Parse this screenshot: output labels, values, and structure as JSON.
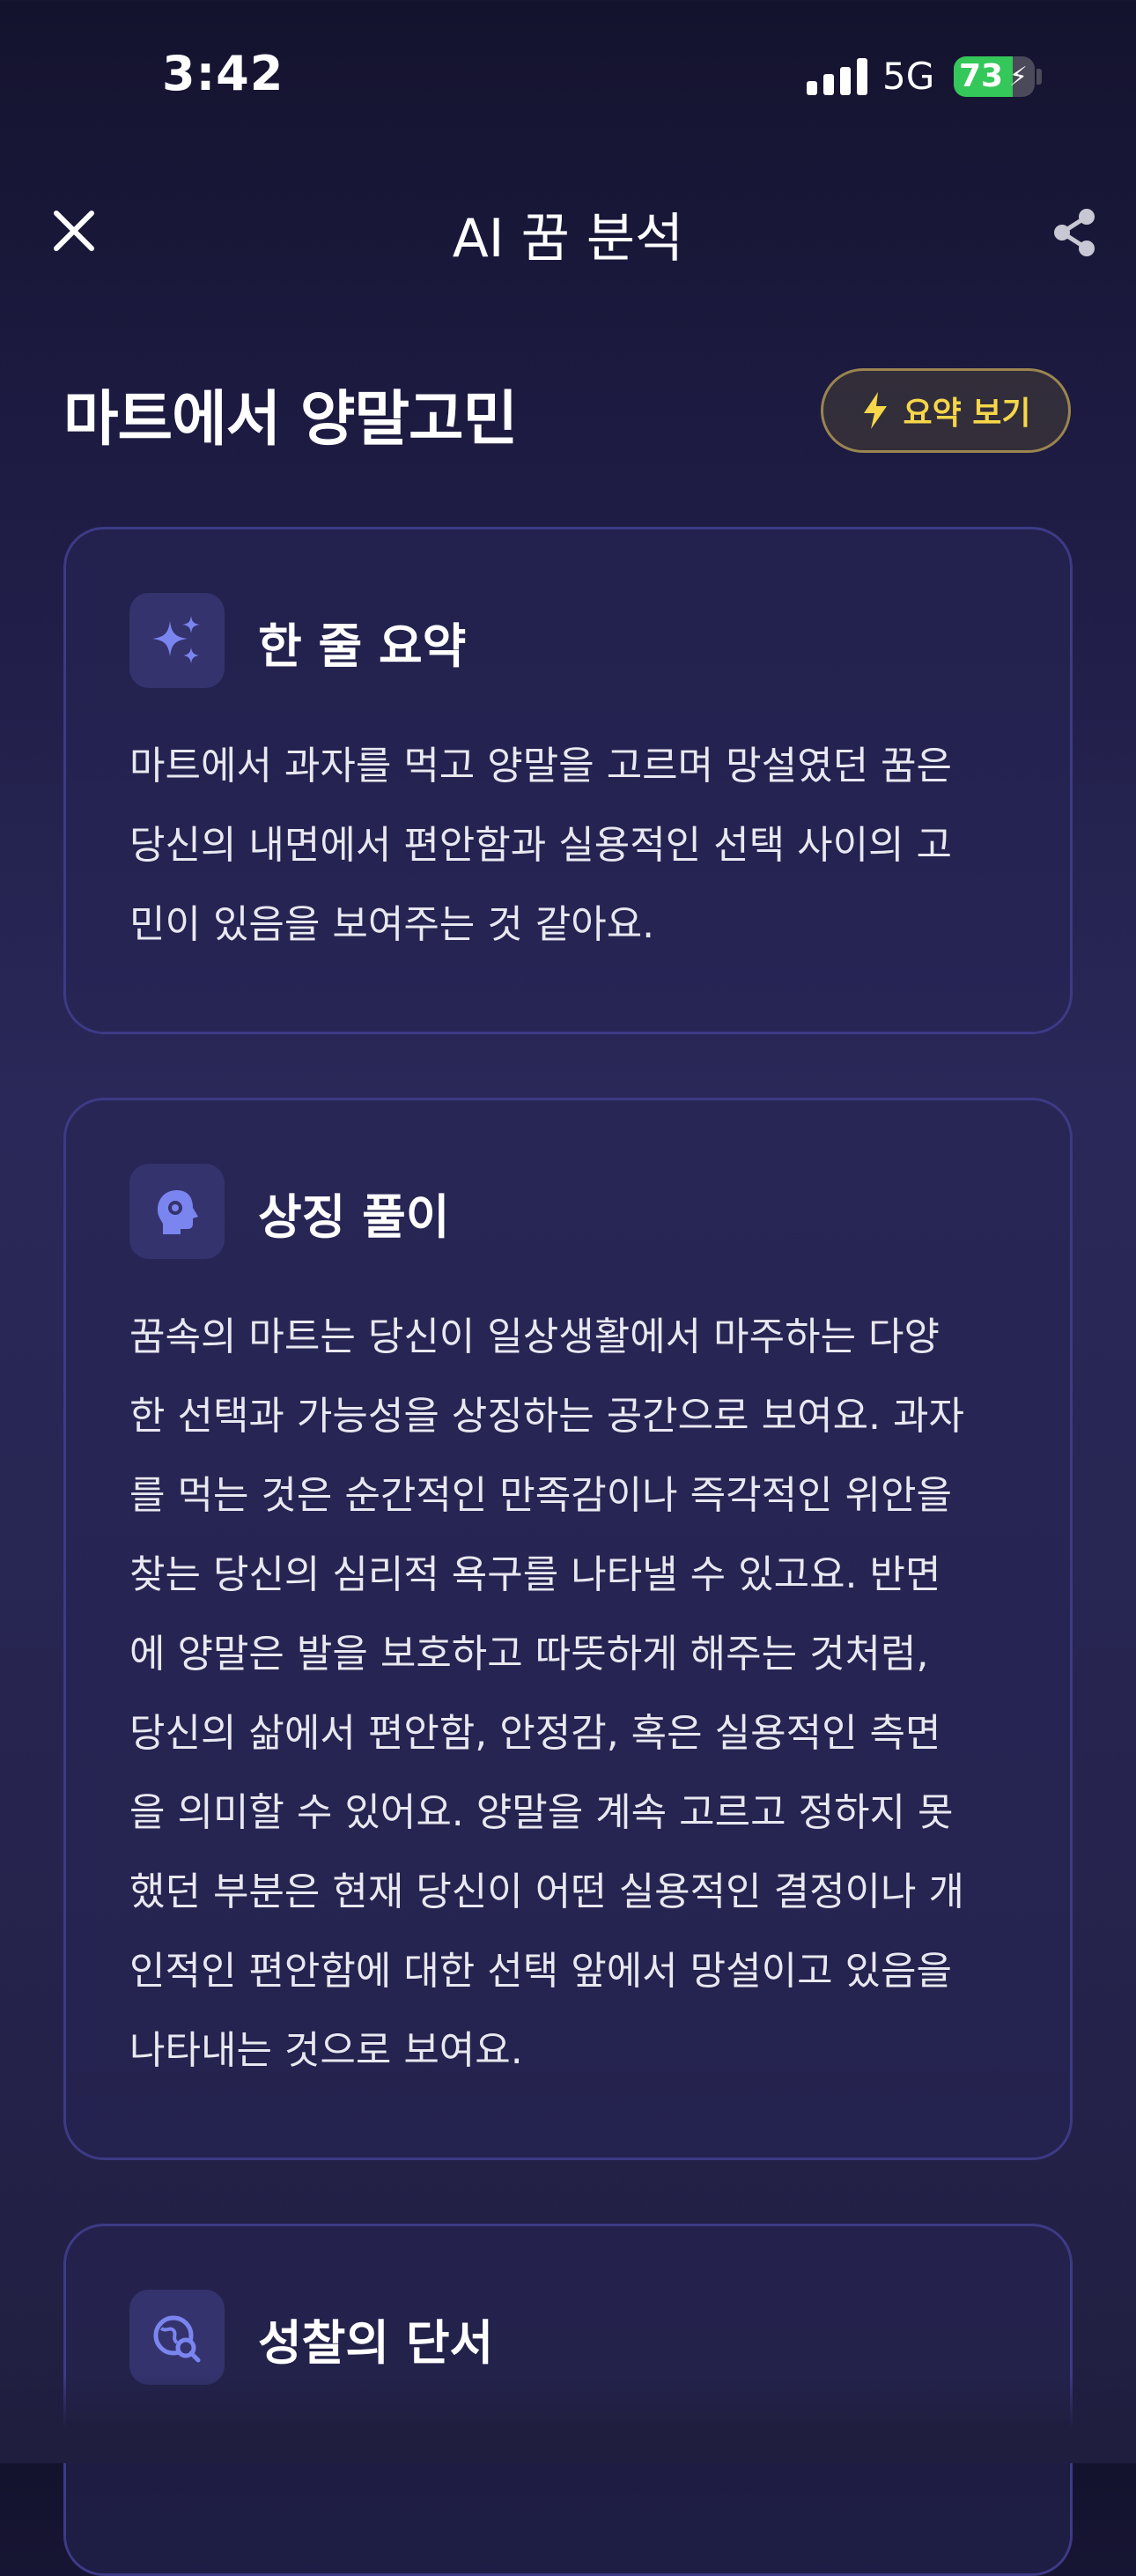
{
  "status_bar": {
    "time": "3:42",
    "network": "5G",
    "battery": "73",
    "battery_level": 0.73
  },
  "nav": {
    "title": "AI 꿈 분석"
  },
  "header": {
    "title": "마트에서 양말고민",
    "summary_button": "요약 보기"
  },
  "cards": [
    {
      "title": "한 줄 요약",
      "icon": "sparkles-icon",
      "lines": [
        "마트에서 과자를 먹고 양말을 고르며 망설였던 꿈은",
        "당신의 내면에서 편안함과 실용적인 선택 사이의 고",
        "민이 있음을 보여주는 것 같아요."
      ]
    },
    {
      "title": "상징 풀이",
      "icon": "head-gear-icon",
      "lines": [
        "꿈속의 마트는 당신이 일상생활에서 마주하는 다양",
        "한 선택과 가능성을 상징하는 공간으로 보여요. 과자",
        "를 먹는 것은 순간적인 만족감이나 즉각적인 위안을",
        "찾는 당신의 심리적 욕구를 나타낼 수 있고요. 반면",
        "에 양말은 발을 보호하고 따뜻하게 해주는 것처럼,",
        "당신의 삶에서 편안함, 안정감, 혹은 실용적인 측면",
        "을 의미할 수 있어요. 양말을 계속 고르고 정하지 못",
        "했던 부분은 현재 당신이 어떤 실용적인 결정이나 개",
        "인적인 편안함에 대한 선택 앞에서 망설이고 있음을",
        "나타내는 것으로 보여요."
      ]
    },
    {
      "title": "성찰의 단서",
      "icon": "globe-search-icon"
    }
  ],
  "colors": {
    "accent": "#7b85f0",
    "summary_button_text": "#f6d64a",
    "battery_green": "#34c759"
  }
}
